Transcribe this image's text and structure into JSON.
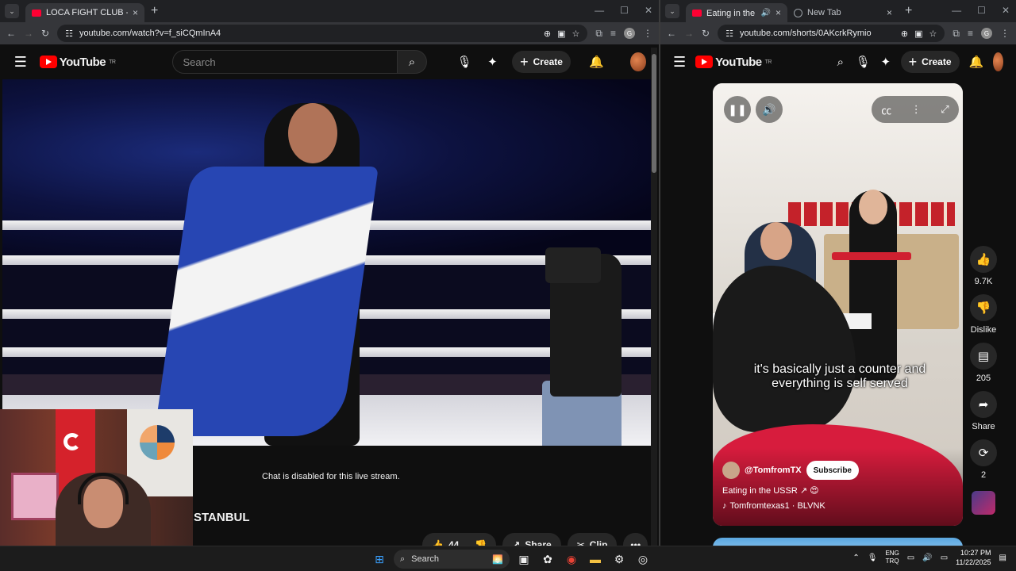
{
  "left_browser": {
    "tab": {
      "title": "LOCA FIGHT CLUB - ORA AREN",
      "close": "×"
    },
    "new_tab": "+",
    "window_controls": [
      "—",
      "☐",
      "✕"
    ],
    "url": "youtube.com/watch?v=f_siCQmInA4",
    "profile_initial": "G"
  },
  "right_browser": {
    "tabs": [
      {
        "title": "Eating in the USSR ↗",
        "close": "×"
      },
      {
        "title": "New Tab",
        "close": "×"
      }
    ],
    "new_tab": "+",
    "window_controls": [
      "—",
      "☐",
      "✕"
    ],
    "url": "youtube.com/shorts/0AKcrkRymio",
    "profile_initial": "G"
  },
  "youtube": {
    "logo_text": "YouTube",
    "region": "TR",
    "search_placeholder": "Search",
    "create_label": "Create"
  },
  "watch": {
    "chat_disabled": "Chat is disabled for this live stream.",
    "title_fragment": "STANBUL",
    "like_count": "44",
    "share_label": "Share",
    "clip_label": "Clip",
    "more": "•••"
  },
  "short": {
    "caption": "it's basically just a counter and everything is self served",
    "channel": "@TomfromTX",
    "subscribe": "Subscribe",
    "title": "Eating in the USSR ↗ 😍",
    "music": "Tomfromtexas1 · BLVNK",
    "actions": {
      "likes": "9.7K",
      "dislike": "Dislike",
      "comments": "205",
      "share": "Share",
      "remix": "2"
    }
  },
  "taskbar": {
    "search_label": "Search",
    "lang_top": "ENG",
    "lang_bottom": "TRQ",
    "time": "10:27 PM",
    "date": "11/22/2025"
  }
}
